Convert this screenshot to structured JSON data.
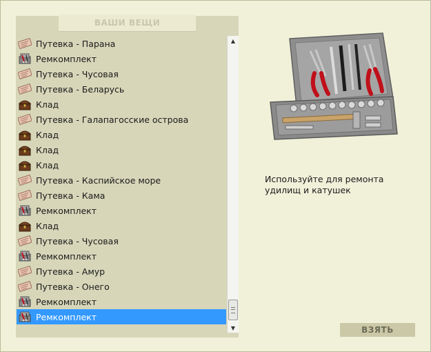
{
  "panel": {
    "title": "ВАШИ ВЕЩИ"
  },
  "items": [
    {
      "label": "Путевка - Парана",
      "icon": "voucher-icon"
    },
    {
      "label": "Ремкомплект",
      "icon": "toolkit-icon"
    },
    {
      "label": "Путевка - Чусовая",
      "icon": "voucher-icon"
    },
    {
      "label": "Путевка - Беларусь",
      "icon": "voucher-icon"
    },
    {
      "label": "Клад",
      "icon": "treasure-chest-icon"
    },
    {
      "label": "Путевка - Галапагосские острова",
      "icon": "voucher-icon"
    },
    {
      "label": "Клад",
      "icon": "treasure-chest-icon"
    },
    {
      "label": "Клад",
      "icon": "treasure-chest-icon"
    },
    {
      "label": "Клад",
      "icon": "treasure-chest-icon"
    },
    {
      "label": "Путевка - Каспийское море",
      "icon": "voucher-icon"
    },
    {
      "label": "Путевка - Кама",
      "icon": "voucher-icon"
    },
    {
      "label": "Ремкомплект",
      "icon": "toolkit-icon"
    },
    {
      "label": "Клад",
      "icon": "treasure-chest-icon"
    },
    {
      "label": "Путевка - Чусовая",
      "icon": "voucher-icon"
    },
    {
      "label": "Ремкомплект",
      "icon": "toolkit-icon"
    },
    {
      "label": "Путевка - Амур",
      "icon": "voucher-icon"
    },
    {
      "label": "Путевка - Онего",
      "icon": "voucher-icon"
    },
    {
      "label": "Ремкомплект",
      "icon": "toolkit-icon"
    },
    {
      "label": "Ремкомплект",
      "icon": "toolkit-icon",
      "selected": true
    }
  ],
  "detail": {
    "image_icon": "toolbox-icon",
    "description": "Используйте для ремонта удилищ и катушек"
  },
  "actions": {
    "take_label": "ВЗЯТЬ"
  },
  "colors": {
    "background": "#f1f1da",
    "panel": "#d7d6b9",
    "selection": "#3399ff",
    "button": "#cac8a6"
  }
}
